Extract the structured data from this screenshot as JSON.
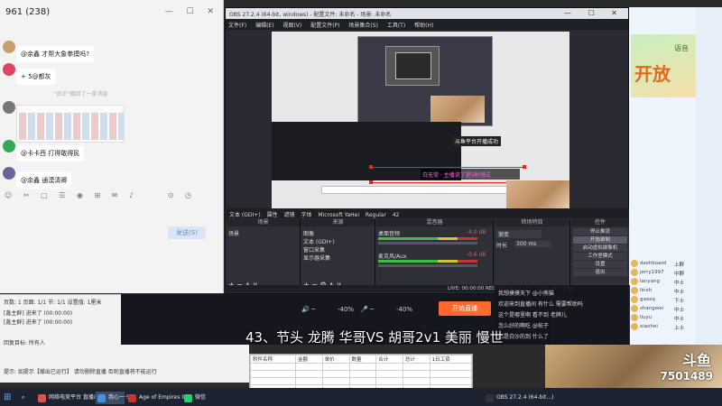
{
  "chat": {
    "title": "961 (238)",
    "messages": [
      {
        "text": "@余鑫 才帮大象拳摸吗?"
      },
      {
        "text": "+ 5@都灰"
      },
      {
        "text": "@卡卡西 打得敢得民"
      },
      {
        "text": "@余鑫 通漠清卿"
      }
    ],
    "system_line": "\"武尔\"撤回了一条消息",
    "send_label": "发送(S)"
  },
  "obs": {
    "title": "OBS 27.2.4 (64-bit, windows) - 配置文件: 未命名 - 场景: 未命名",
    "menu": [
      "文件(F)",
      "编辑(E)",
      "视图(V)",
      "配置文件(P)",
      "场景集合(S)",
      "工具(T)",
      "帮助(H)"
    ],
    "preview_overlay_text": "斗鱼平台开播成功",
    "ticker_text": "白无常 · 主播说了是5秒测试",
    "source_bar": [
      "文本 (GDI+)",
      "属性",
      "滤镜",
      "字体",
      "Microsoft YaHei",
      "Regular",
      "42"
    ],
    "docks": {
      "scenes": "场景",
      "sources": "来源",
      "mixer": "混音器",
      "transitions": "转场特效",
      "controls": "控件"
    },
    "scene_items": [
      "场景"
    ],
    "source_items": [
      "图像",
      "文本 (GDI+)",
      "窗口采集",
      "显示器采集"
    ],
    "mixer_tracks": [
      {
        "name": "桌面音频",
        "db": "-4.0 dB"
      },
      {
        "name": "麦克风/Aux",
        "db": "-0.6 dB"
      }
    ],
    "transition": {
      "type": "渐变",
      "duration_label": "时长",
      "duration": "300 ms"
    },
    "controls": [
      "停止推流",
      "开始录制",
      "启动虚拟摄像机",
      "工作室模式",
      "设置",
      "退出"
    ],
    "status_bar": "LIVE: 00:00:00   REC: 00:00:00   CPU: 1.5%, 60.00 fps"
  },
  "audio_bar": {
    "volume_a": "-40%",
    "volume_b": "-40%",
    "start_label": "开始直播"
  },
  "subtitle": "43、节头 龙腾 华哥VS 胡哥2v1 美丽 慢世",
  "chat_feed": [
    "我想摸摸天下 @小熊猫",
    "欢迎来到直播间 有什么 需要帮助吗",
    "这个是哪里啊 看不到 老牌儿",
    "怎么好的啊吃 @帖子",
    "都是白沙的到 什么了"
  ],
  "qq_panel": {
    "banner_big": "开放",
    "banner_label": "语音",
    "members": [
      {
        "name": "dashboard",
        "role": "上群"
      },
      {
        "name": "jerry1997",
        "role": "中群"
      },
      {
        "name": "lanyang",
        "role": "中士"
      },
      {
        "name": "linxh",
        "role": "中士"
      },
      {
        "name": "gaoxq",
        "role": "下士"
      },
      {
        "name": "zhangwei",
        "role": "中士"
      },
      {
        "name": "liuyu",
        "role": "中士"
      },
      {
        "name": "xiaohei",
        "role": "上士"
      }
    ],
    "count": "7501489"
  },
  "qq_bar": {
    "rows": [
      "页数: 1  页面: 1/1  节: 1/1  设置值: 1厘米",
      "[鑫主群] 进来了 (00:00:00)",
      "[鑫主群] 进来了 (00:00:00)",
      "回复目标:  所有人",
      "提示: 如提示【撤出已运行】 请勿删除直播 否则直播将不能运行"
    ]
  },
  "sheet": {
    "headers": [
      "附件名称",
      "金额",
      "单价",
      "数量",
      "合计",
      "总计",
      "1日工资"
    ]
  },
  "taskbar": [
    {
      "label": "网络电竞平台 直播出处",
      "color": "#d9534f"
    },
    {
      "label": "我心一·5",
      "color": "#4a90d9"
    },
    {
      "label": "Age of Empires II...",
      "color": "#c0392b"
    },
    {
      "label": "微信",
      "color": "#2ecc71"
    },
    {
      "label": "OBS 27.2.4 (64-bit...)",
      "color": "#333"
    }
  ],
  "cam": {
    "logo": "斗鱼",
    "viewers": "7501489"
  }
}
